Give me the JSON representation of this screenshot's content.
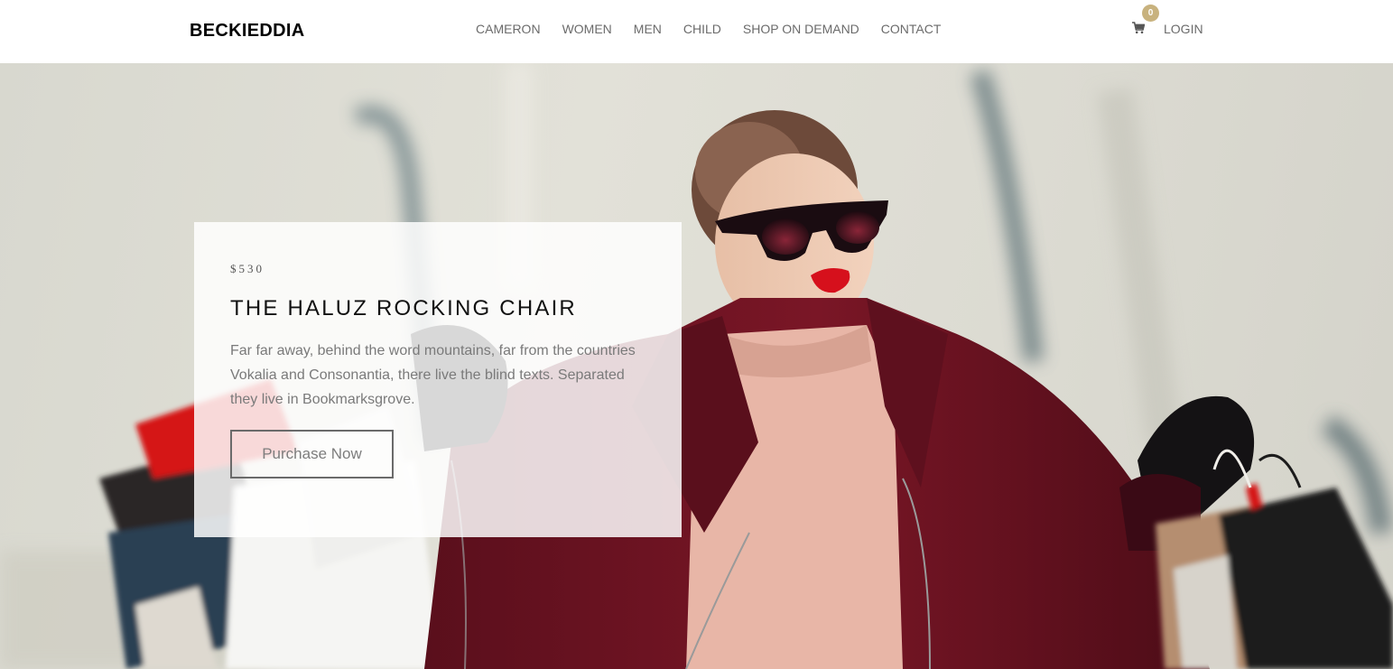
{
  "brand": {
    "name": "BECKIEDDIA"
  },
  "nav": {
    "items": [
      {
        "label": "CAMERON"
      },
      {
        "label": "WOMEN"
      },
      {
        "label": "MEN"
      },
      {
        "label": "CHILD"
      },
      {
        "label": "SHOP ON DEMAND"
      },
      {
        "label": "CONTACT"
      }
    ],
    "cart_count": "0",
    "cart_icon": "shopping-cart-icon",
    "login_label": "LOGIN"
  },
  "hero": {
    "price": "$530",
    "title": "THE HALUZ ROCKING CHAIR",
    "description": "Far far away, behind the word mountains, far from the countries Vokalia and Consonantia, there live the blind texts. Separated they live in Bookmarksgrove.",
    "button_label": "Purchase Now"
  },
  "colors": {
    "accent_badge": "#c8b27e",
    "nav_text": "#6b6b6b",
    "coat": "#6e1422",
    "lipstick": "#d6101c"
  }
}
